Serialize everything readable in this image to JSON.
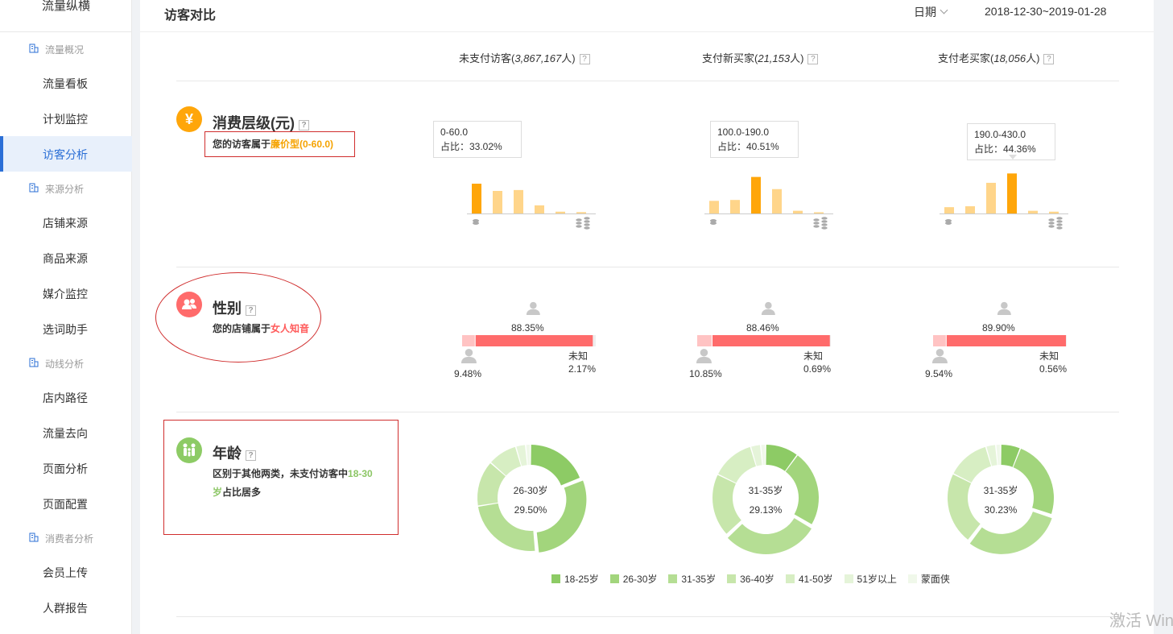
{
  "sidebar": {
    "top_item": "流量纵横",
    "groups": [
      {
        "label": "流量概况",
        "items": [
          "流量看板",
          "计划监控",
          "访客分析"
        ]
      },
      {
        "label": "来源分析",
        "items": [
          "店铺来源",
          "商品来源",
          "媒介监控",
          "选词助手"
        ]
      },
      {
        "label": "动线分析",
        "items": [
          "店内路径",
          "流量去向",
          "页面分析",
          "页面配置"
        ]
      },
      {
        "label": "消费者分析",
        "items": [
          "会员上传",
          "人群报告"
        ]
      }
    ],
    "active_item": "访客分析"
  },
  "header": {
    "title": "访客对比",
    "date_label": "日期",
    "date_range": "2018-12-30~2019-01-28"
  },
  "columns": [
    {
      "label": "未支付访客(",
      "count": "3,867,167",
      "suffix": "人)"
    },
    {
      "label": "支付新买家(",
      "count": "21,153",
      "suffix": "人)"
    },
    {
      "label": "支付老买家(",
      "count": "18,056",
      "suffix": "人)"
    }
  ],
  "help_mark": "?",
  "consumption": {
    "title": "消费层级(元)",
    "icon": "yen-icon",
    "desc_prefix": "您的访客属于",
    "desc_highlight": "廉价型(0-60.0)",
    "tooltips": [
      {
        "range": "0-60.0",
        "ratio": "占比：33.02%"
      },
      {
        "range": "100.0-190.0",
        "ratio": "占比：40.51%"
      },
      {
        "range": "190.0-430.0",
        "ratio": "占比：44.36%"
      }
    ]
  },
  "gender": {
    "title": "性别",
    "icon": "people-icon",
    "desc_prefix": "您的店铺属于",
    "desc_highlight": "女人知音",
    "unknown_label": "未知",
    "columns": [
      {
        "female": "88.35%",
        "male": "9.48%",
        "unknown": "2.17%",
        "female_v": 88.35,
        "male_v": 9.48,
        "unknown_v": 2.17
      },
      {
        "female": "88.46%",
        "male": "10.85%",
        "unknown": "0.69%",
        "female_v": 88.46,
        "male_v": 10.85,
        "unknown_v": 0.69
      },
      {
        "female": "89.90%",
        "male": "9.54%",
        "unknown": "0.56%",
        "female_v": 89.9,
        "male_v": 9.54,
        "unknown_v": 0.56
      }
    ]
  },
  "age": {
    "title": "年龄",
    "icon": "family-icon",
    "desc_prefix": "区别于其他两类，未支付访客中",
    "desc_highlight": "18-30岁",
    "desc_suffix": "占比居多",
    "centers": [
      {
        "label": "26-30岁",
        "value": "29.50%"
      },
      {
        "label": "31-35岁",
        "value": "29.13%"
      },
      {
        "label": "31-35岁",
        "value": "30.23%"
      }
    ],
    "legend": [
      "18-25岁",
      "26-30岁",
      "31-35岁",
      "36-40岁",
      "41-50岁",
      "51岁以上",
      "蒙面侠"
    ]
  },
  "colors": {
    "orange": "#ffa60a",
    "orange_light": "#ffd58a",
    "female": "#ff6b6b",
    "male": "#ffc3c3",
    "age_palette": [
      "#8dcb65",
      "#a2d57c",
      "#b5de94",
      "#c7e6ab",
      "#d7eec3",
      "#e5f4d9",
      "#f0f8ea"
    ]
  },
  "chart_data": [
    {
      "type": "bar",
      "series": [
        {
          "values": [
            33.02,
            25,
            26,
            9,
            2,
            1.5
          ]
        },
        {
          "values": [
            14,
            15,
            40.51,
            27,
            3,
            1
          ]
        },
        {
          "values": [
            7,
            8,
            34,
            44.36,
            3,
            2
          ]
        }
      ],
      "highlight_index": [
        0,
        2,
        3
      ],
      "ylim": [
        0,
        50
      ]
    },
    {
      "type": "pie",
      "categories": [
        "18-25岁",
        "26-30岁",
        "31-35岁",
        "36-40岁",
        "41-50岁",
        "51岁以上",
        "蒙面侠"
      ],
      "series": [
        {
          "values": [
            19,
            29.5,
            24,
            14,
            9,
            3,
            1.5
          ]
        },
        {
          "values": [
            10,
            23,
            29.13,
            19,
            13,
            3,
            1.5
          ]
        },
        {
          "values": [
            6,
            24,
            30.23,
            22,
            13,
            3,
            1.5
          ]
        }
      ]
    }
  ],
  "watermark": "激活 Win"
}
